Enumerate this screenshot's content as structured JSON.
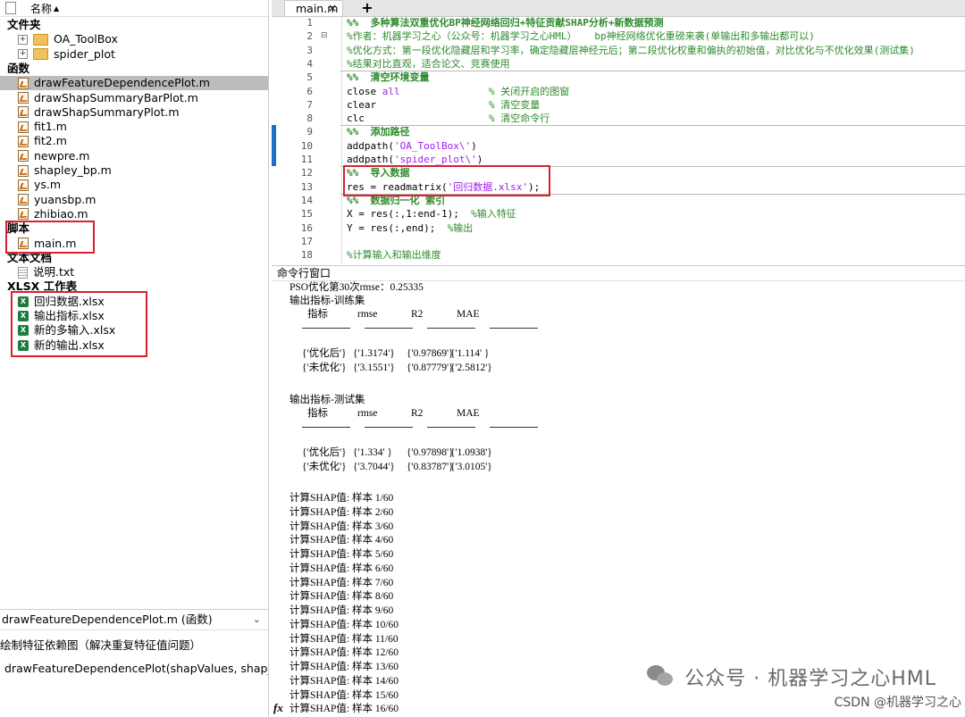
{
  "file_browser": {
    "header_label": "名称",
    "sections": {
      "folders": "文件夹",
      "functions": "函数",
      "scripts": "脚本",
      "text_docs": "文本文档",
      "xlsx": "XLSX 工作表"
    },
    "folders": [
      "OA_ToolBox",
      "spider_plot"
    ],
    "functions": [
      "drawFeatureDependencePlot.m",
      "drawShapSummaryBarPlot.m",
      "drawShapSummaryPlot.m",
      "fit1.m",
      "fit2.m",
      "newpre.m",
      "shapley_bp.m",
      "ys.m",
      "yuansbp.m",
      "zhibiao.m"
    ],
    "selected_function": "drawFeatureDependencePlot.m",
    "scripts": [
      "main.m"
    ],
    "text_docs": [
      "说明.txt"
    ],
    "xlsx_files": [
      "回归数据.xlsx",
      "输出指标.xlsx",
      "新的多输入.xlsx",
      "新的输出.xlsx"
    ]
  },
  "details": {
    "title": "drawFeatureDependencePlot.m  (函数)",
    "description": "绘制特征依赖图（解决重复特征值问题）",
    "signature": "drawFeatureDependencePlot(shapValues, shap_..."
  },
  "editor": {
    "tab_label": "main.m",
    "lines": [
      {
        "n": "1",
        "parts": [
          [
            "sec",
            "%%  多种算法双重优化BP神经网络回归+特征贡献SHAP分析+新数据预测"
          ]
        ]
      },
      {
        "n": "2",
        "parts": [
          [
            "com",
            "%作者：机器学习之心（公众号：机器学习之心HML）   bp神经网络优化重磅来袭(单输出和多输出都可以)"
          ]
        ]
      },
      {
        "n": "3",
        "parts": [
          [
            "com",
            "%优化方式：第一段优化隐藏层和学习率，确定隐藏层神经元后；第二段优化权重和偏执的初始值，对比优化与不优化效果(测试集)"
          ]
        ]
      },
      {
        "n": "4",
        "parts": [
          [
            "com",
            "%结果对比直观，适合论文、竞赛使用"
          ]
        ]
      },
      {
        "n": "5",
        "parts": [
          [
            "sec",
            "%%  清空环境变量"
          ]
        ]
      },
      {
        "n": "6",
        "parts": [
          [
            "kw",
            "close "
          ],
          [
            "key",
            "all"
          ],
          [
            "kw",
            "               "
          ],
          [
            "com",
            "% 关闭开启的图窗"
          ]
        ]
      },
      {
        "n": "7",
        "parts": [
          [
            "kw",
            "clear                   "
          ],
          [
            "com",
            "% 清空变量"
          ]
        ]
      },
      {
        "n": "8",
        "parts": [
          [
            "kw",
            "clc                     "
          ],
          [
            "com",
            "% 清空命令行"
          ]
        ]
      },
      {
        "n": "9",
        "parts": [
          [
            "sec",
            "%%  添加路径"
          ]
        ]
      },
      {
        "n": "10",
        "parts": [
          [
            "kw",
            "addpath("
          ],
          [
            "str",
            "'OA_ToolBox\\'"
          ],
          [
            "kw",
            ")"
          ]
        ]
      },
      {
        "n": "11",
        "parts": [
          [
            "kw",
            "addpath("
          ],
          [
            "str",
            "'spider_plot\\'"
          ],
          [
            "kw",
            ")"
          ]
        ]
      },
      {
        "n": "12",
        "parts": [
          [
            "sec",
            "%%  导入数据"
          ]
        ]
      },
      {
        "n": "13",
        "parts": [
          [
            "kw",
            "res = readmatrix("
          ],
          [
            "str",
            "'回归数据.xlsx'"
          ],
          [
            "kw",
            ");"
          ]
        ]
      },
      {
        "n": "14",
        "parts": [
          [
            "sec",
            "%%  数据归一化 索引"
          ]
        ]
      },
      {
        "n": "15",
        "parts": [
          [
            "kw",
            "X = res(:,1:end-1);  "
          ],
          [
            "com",
            "%输入特征"
          ]
        ]
      },
      {
        "n": "16",
        "parts": [
          [
            "kw",
            "Y = res(:,end);  "
          ],
          [
            "com",
            "%输出"
          ]
        ]
      },
      {
        "n": "17",
        "parts": []
      },
      {
        "n": "18",
        "parts": [
          [
            "com",
            "%计算输入和输出维度"
          ]
        ]
      }
    ]
  },
  "command_window": {
    "title": "命令行窗口",
    "partial_top": "PSO优化第30次rmse：0.25335",
    "train_title": "输出指标-训练集",
    "test_title": "输出指标-测试集",
    "headers": [
      "指标",
      "rmse",
      "R2",
      "MAE"
    ],
    "train_rows": [
      [
        "{'优化后'}",
        "{'1.3174'}",
        "{'0.97869'}",
        "{'1.114' }"
      ],
      [
        "{'未优化'}",
        "{'3.1551'}",
        "{'0.87779'}",
        "{'2.5812'}"
      ]
    ],
    "test_rows": [
      [
        "{'优化后'}",
        "{'1.334' }",
        "{'0.97898'}",
        "{'1.0938'}"
      ],
      [
        "{'未优化'}",
        "{'3.7044'}",
        "{'0.83787'}",
        "{'3.0105'}"
      ]
    ],
    "shap_lines": [
      "计算SHAP值: 样本 1/60",
      "计算SHAP值: 样本 2/60",
      "计算SHAP值: 样本 3/60",
      "计算SHAP值: 样本 4/60",
      "计算SHAP值: 样本 5/60",
      "计算SHAP值: 样本 6/60",
      "计算SHAP值: 样本 7/60",
      "计算SHAP值: 样本 8/60",
      "计算SHAP值: 样本 9/60",
      "计算SHAP值: 样本 10/60",
      "计算SHAP值: 样本 11/60",
      "计算SHAP值: 样本 12/60",
      "计算SHAP值: 样本 13/60",
      "计算SHAP值: 样本 14/60",
      "计算SHAP值: 样本 15/60",
      "计算SHAP值: 样本 16/60"
    ],
    "fx_label": "fx"
  },
  "watermark": {
    "main": "公众号 · 机器学习之心HML",
    "sub": "CSDN @机器学习之心"
  },
  "colors": {
    "section_comment": "#2e8b2e",
    "string": "#a020f0",
    "highlight_box": "#d8212d",
    "selection": "#bcbcbc",
    "cell_band": "#1f6fc8"
  }
}
